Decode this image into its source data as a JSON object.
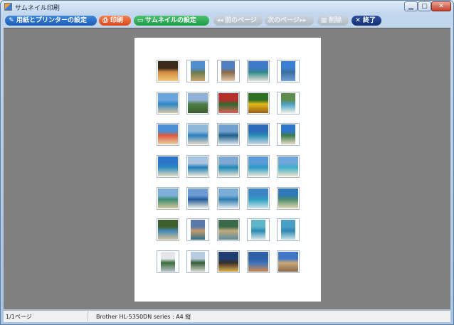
{
  "window": {
    "title": "サムネイル印刷"
  },
  "toolbar": {
    "page_setup": "用紙とプリンターの設定",
    "print": "印刷",
    "thumbnail_settings": "サムネイルの設定",
    "prev_page": "前のページ",
    "next_page": "次のページ",
    "delete": "削除",
    "exit": "終了"
  },
  "icons": {
    "page_setup": "wrench-icon",
    "print": "printer-icon",
    "thumbnail_settings": "monitor-icon",
    "prev_page": "rewind-icon",
    "next_page": "fast-forward-icon",
    "delete": "trash-icon",
    "exit": "close-icon"
  },
  "colors": {
    "blue": "#1c5db4",
    "red": "#d9481d",
    "green": "#1f9b49",
    "gray": "#aeb8c4",
    "navy": "#142f74",
    "workspace": "#808080"
  },
  "thumbnails": [
    [
      "#3a2a1a",
      "#d38b3f",
      "#f2c77a"
    ],
    [
      "#4f8ecf",
      "#6a7a52",
      "#c9a66b"
    ],
    [
      "#4f7fc0",
      "#8c6a4a",
      "#e0c8a8"
    ],
    [
      "#3f79c8",
      "#2d8a89",
      "#e2e2d8"
    ],
    [
      "#3a7fd1",
      "#3c6d9f",
      "#6fa0d8"
    ],
    [
      "#6aa5de",
      "#2c86c6",
      "#d7c8a0"
    ],
    [
      "#8fb2d6",
      "#4d7d41",
      "#3c5f31"
    ],
    [
      "#b52e2a",
      "#2f6b2f",
      "#e05e56"
    ],
    [
      "#2f6f22",
      "#e2b819",
      "#9a5b18"
    ],
    [
      "#5d8c4e",
      "#4aa0c7",
      "#e9f2e6"
    ],
    [
      "#4d8fd5",
      "#e05a3d",
      "#e8d2a8"
    ],
    [
      "#8fb6db",
      "#2c7fbe",
      "#e4d8c2"
    ],
    [
      "#6fa0cf",
      "#1f5f8a",
      "#d8e3ea"
    ],
    [
      "#2d69b9",
      "#2b8fb7",
      "#c9d7e8"
    ],
    [
      "#2d76c8",
      "#3c7a4a",
      "#e7dcc5"
    ],
    [
      "#2c76c9",
      "#2c8dbf",
      "#e7ddc2"
    ],
    [
      "#a8c4de",
      "#1f7fb7",
      "#f0ead9"
    ],
    [
      "#7fa7d3",
      "#1d8ab8",
      "#eee6d3"
    ],
    [
      "#5a9ad7",
      "#2a9ac6",
      "#efe8d6"
    ],
    [
      "#6fa6dc",
      "#3cb0c8",
      "#efe5cc"
    ],
    [
      "#7fb0dc",
      "#3a8d74",
      "#d8c79d"
    ],
    [
      "#6c9bd3",
      "#245c9a",
      "#f0efe9"
    ],
    [
      "#7aaed8",
      "#2b7bb2",
      "#e6ebee"
    ],
    [
      "#3d86c6",
      "#2a9fc2",
      "#cde5ea"
    ],
    [
      "#2f79b8",
      "#4a8d6b",
      "#e6d9b9"
    ],
    [
      "#3d5f2a",
      "#3e88b8",
      "#d9c29a"
    ],
    [
      "#5a79a8",
      "#c49a68",
      "#2f6f8f"
    ],
    [
      "#3b6a4a",
      "#c2a97a",
      "#5a8c9f"
    ],
    [
      "#5fb6c8",
      "#2a8ab3",
      "#d9e9e8"
    ],
    [
      "#4a9fc6",
      "#2f86b0",
      "#c7e3ea"
    ],
    [
      "#e4e7ea",
      "#3b6d3a",
      "#b8c4cc"
    ],
    [
      "#b8cde0",
      "#355d35",
      "#d6d6cf"
    ],
    [
      "#1f3d72",
      "#3a2e2a",
      "#e0b04a"
    ],
    [
      "#2f5fa6",
      "#3c73bf",
      "#d28a4a"
    ],
    [
      "#3f76c8",
      "#c9a776",
      "#8c6a4a"
    ]
  ],
  "status": {
    "page": "1/1ページ",
    "printer": "Brother HL-5350DN series : A4 縦"
  }
}
